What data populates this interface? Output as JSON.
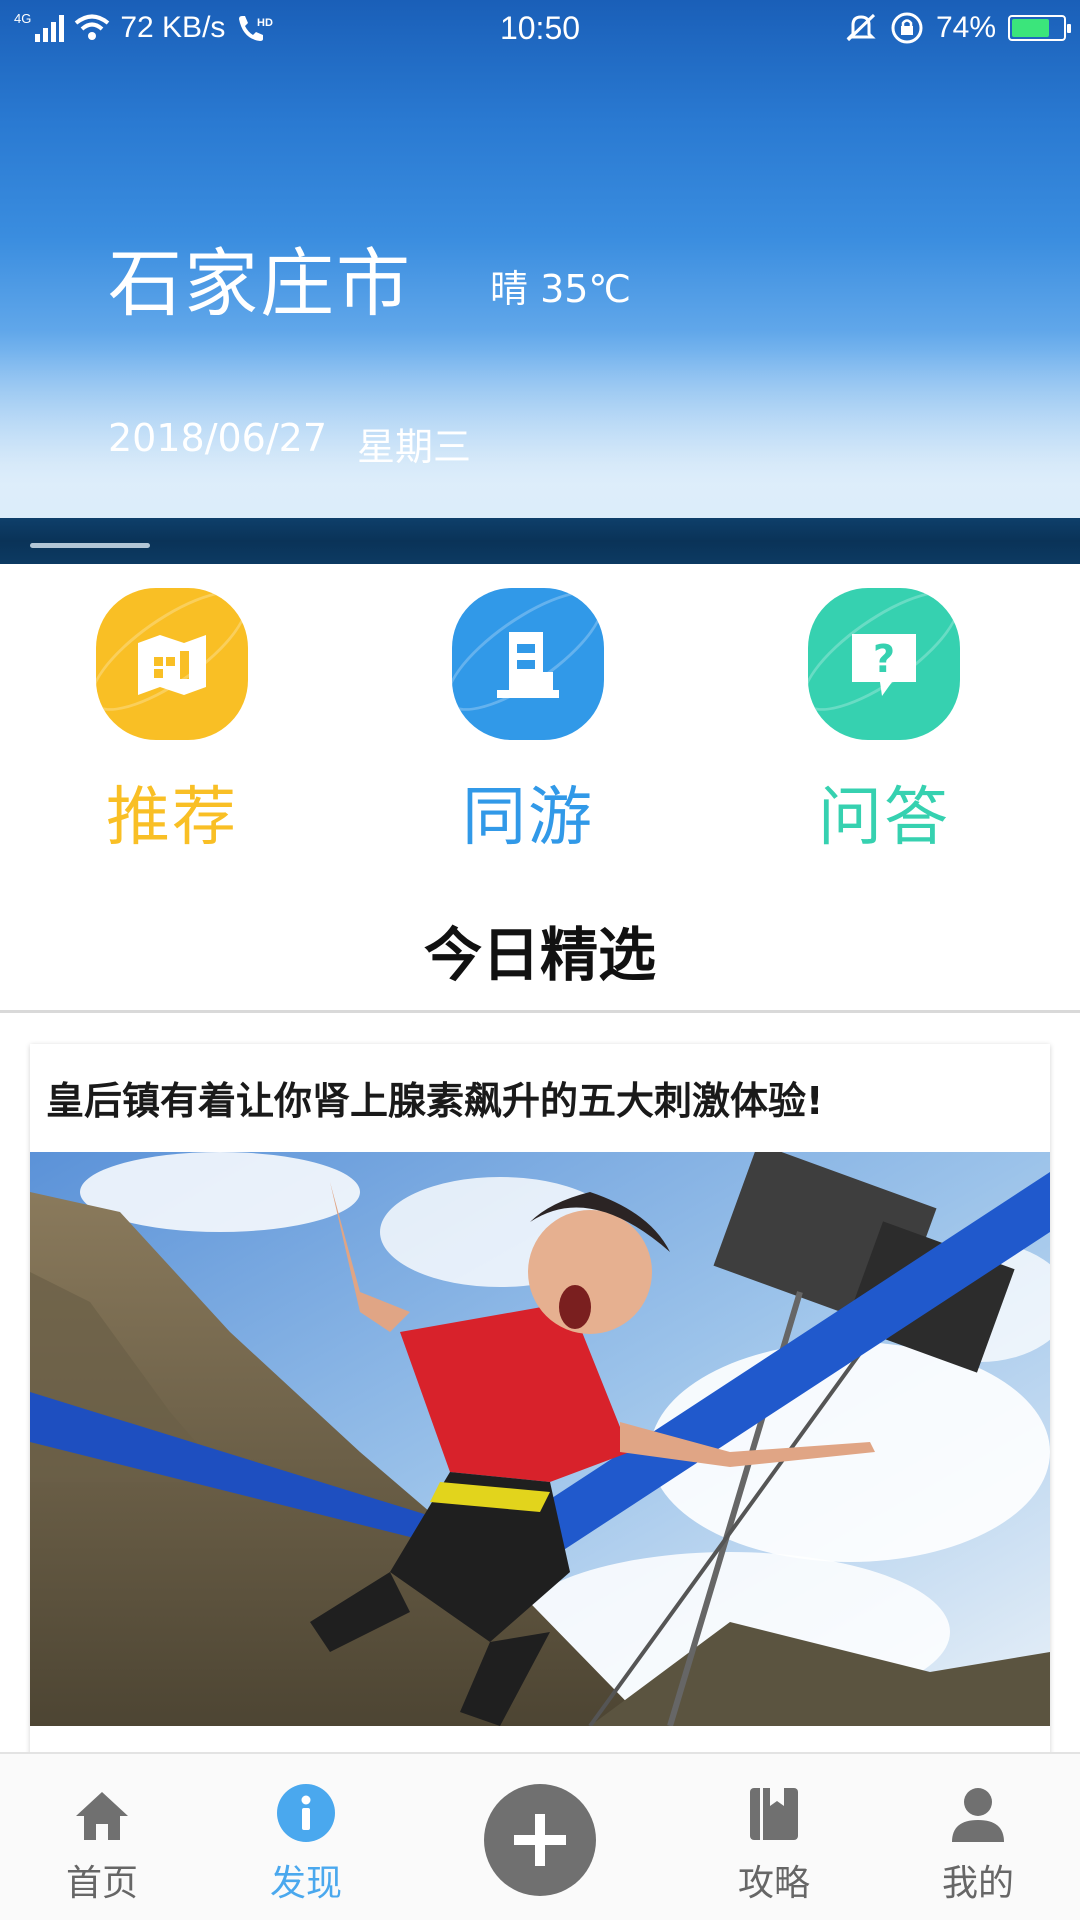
{
  "status_bar": {
    "network": "4G",
    "speed": "72 KB/s",
    "call_badge": "HD",
    "time": "10:50",
    "battery": "74%",
    "battery_level": 0.74
  },
  "hero": {
    "city": "石家庄市",
    "weather": "晴 35℃",
    "date": "2018/06/27",
    "weekday": "星期三"
  },
  "actions": [
    {
      "label": "推荐",
      "icon": "map-book-icon",
      "color": "#f9bf25"
    },
    {
      "label": "同游",
      "icon": "building-icon",
      "color": "#3199e8"
    },
    {
      "label": "问答",
      "icon": "question-bubble-icon",
      "color": "#36d1b0"
    }
  ],
  "section_title": "今日精选",
  "article": {
    "title": "皇后镇有着让你肾上腺素飙升的五大刺激体验!"
  },
  "bottom_nav": [
    {
      "label": "首页",
      "icon": "home-icon",
      "active": false
    },
    {
      "label": "发现",
      "icon": "info-icon",
      "active": true
    },
    {
      "label": "",
      "icon": "plus-icon",
      "active": false
    },
    {
      "label": "攻略",
      "icon": "book-icon",
      "active": false
    },
    {
      "label": "我的",
      "icon": "user-icon",
      "active": false
    }
  ],
  "colors": {
    "accent": "#4aa8ee",
    "nav_inactive": "#666666"
  }
}
